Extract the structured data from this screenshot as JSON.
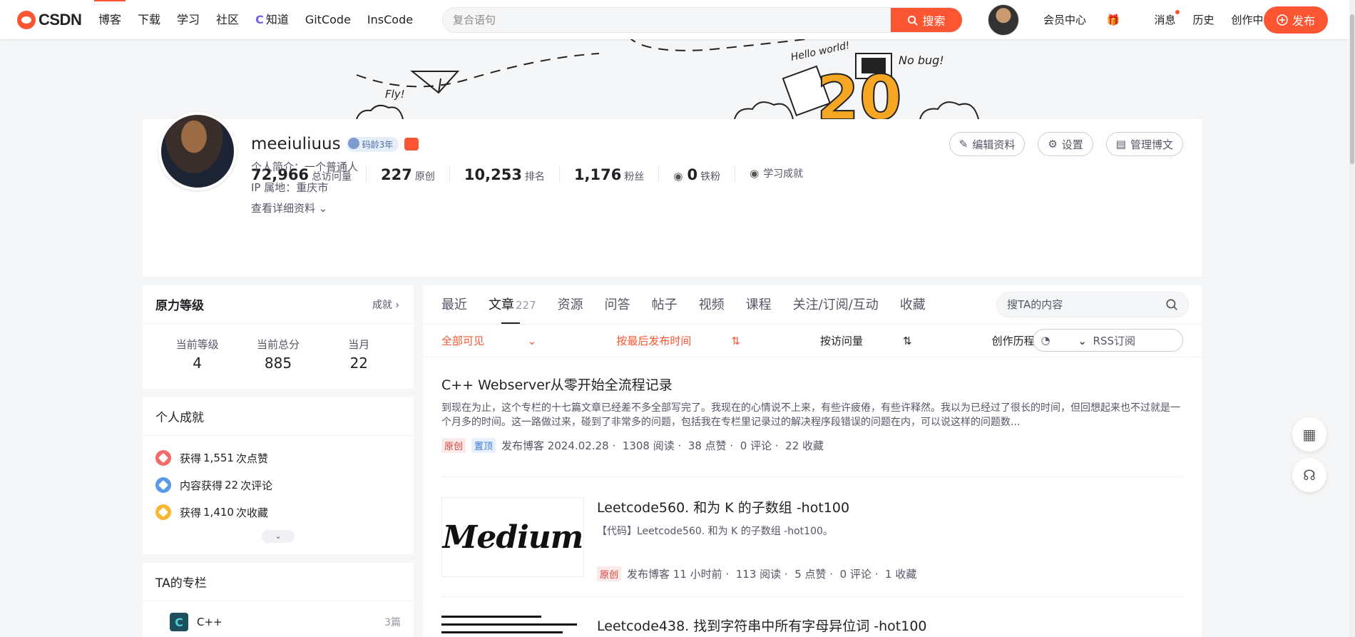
{
  "nav": {
    "logo": "CSDN",
    "links": [
      "博客",
      "下载",
      "学习",
      "社区",
      "知道",
      "GitCode",
      "InsCode"
    ],
    "search_placeholder": "复合语句",
    "search_button": "搜索",
    "right": [
      "会员中心",
      "消息",
      "历史",
      "创作中心"
    ],
    "publish": "发布"
  },
  "banner": {
    "texts": [
      "Fly!",
      "Hello world!",
      "No bug!",
      "20"
    ]
  },
  "profile": {
    "username": "meeiuliuus",
    "age_badge": "码龄3年",
    "stats": [
      {
        "value": "72,966",
        "label": "总访问量"
      },
      {
        "value": "227",
        "label": "原创"
      },
      {
        "value": "10,253",
        "label": "排名"
      },
      {
        "value": "1,176",
        "label": "粉丝"
      },
      {
        "value": "0",
        "label": "铁粉"
      }
    ],
    "learning": "学习成就",
    "intro": "个人简介：一个普通人",
    "ip": "IP 属地：重庆市",
    "details": "查看详细资料",
    "buttons": [
      "编辑资料",
      "设置",
      "管理博文"
    ]
  },
  "level": {
    "title": "原力等级",
    "more": "成就",
    "items": [
      {
        "label": "当前等级",
        "value": "4"
      },
      {
        "label": "当前总分",
        "value": "885"
      },
      {
        "label": "当月",
        "value": "22"
      }
    ]
  },
  "achievements": {
    "title": "个人成就",
    "items": [
      {
        "prefix": "获得 ",
        "num": "1,551",
        "suffix": " 次点赞",
        "color": "#f36a6a"
      },
      {
        "prefix": "内容获得 ",
        "num": "22",
        "suffix": " 次评论",
        "color": "#5b9ae8"
      },
      {
        "prefix": "获得 ",
        "num": "1,410",
        "suffix": " 次收藏",
        "color": "#f7b731"
      }
    ]
  },
  "columns": {
    "title": "TA的专栏",
    "items": [
      {
        "name": "C++",
        "count": "3篇"
      }
    ]
  },
  "tabs": {
    "items": [
      "最近",
      "文章",
      "资源",
      "问答",
      "帖子",
      "视频",
      "课程",
      "关注/订阅/互动",
      "收藏"
    ],
    "article_count": "227",
    "search_placeholder": "搜TA的内容"
  },
  "filters": {
    "visibility": "全部可见",
    "sort_time": "按最后发布时间",
    "sort_views": "按访问量",
    "history": "创作历程",
    "rss": "RSS订阅"
  },
  "articles": [
    {
      "title": "C++ Webserver从零开始全流程记录",
      "desc": "到现在为止，这个专栏的十七篇文章已经差不多全部写完了。我现在的心情说不上来，有些许疲倦，有些许释然。我以为已经过了很长的时间，但回想起来也不过就是一个月多的时间。这一路做过来，碰到了非常多的问题，包括我在专栏里记录过的解决程序段错误的问题在内，可以说这样的问题数...",
      "tags": [
        "原创",
        "置顶"
      ],
      "meta": [
        "发布博客 2024.02.28 ·",
        "1308 阅读 ·",
        "38 点赞 ·",
        "0 评论 ·",
        "22 收藏"
      ]
    },
    {
      "title": "Leetcode560. 和为 K 的子数组 -hot100",
      "desc": "【代码】Leetcode560. 和为 K 的子数组 -hot100。",
      "thumb": "Medium",
      "tags": [
        "原创"
      ],
      "meta": [
        "发布博客 11 小时前 ·",
        "113 阅读 ·",
        "5 点赞 ·",
        "0 评论 ·",
        "1 收藏"
      ]
    },
    {
      "title": "Leetcode438. 找到字符串中所有字母异位词 -hot100"
    }
  ]
}
